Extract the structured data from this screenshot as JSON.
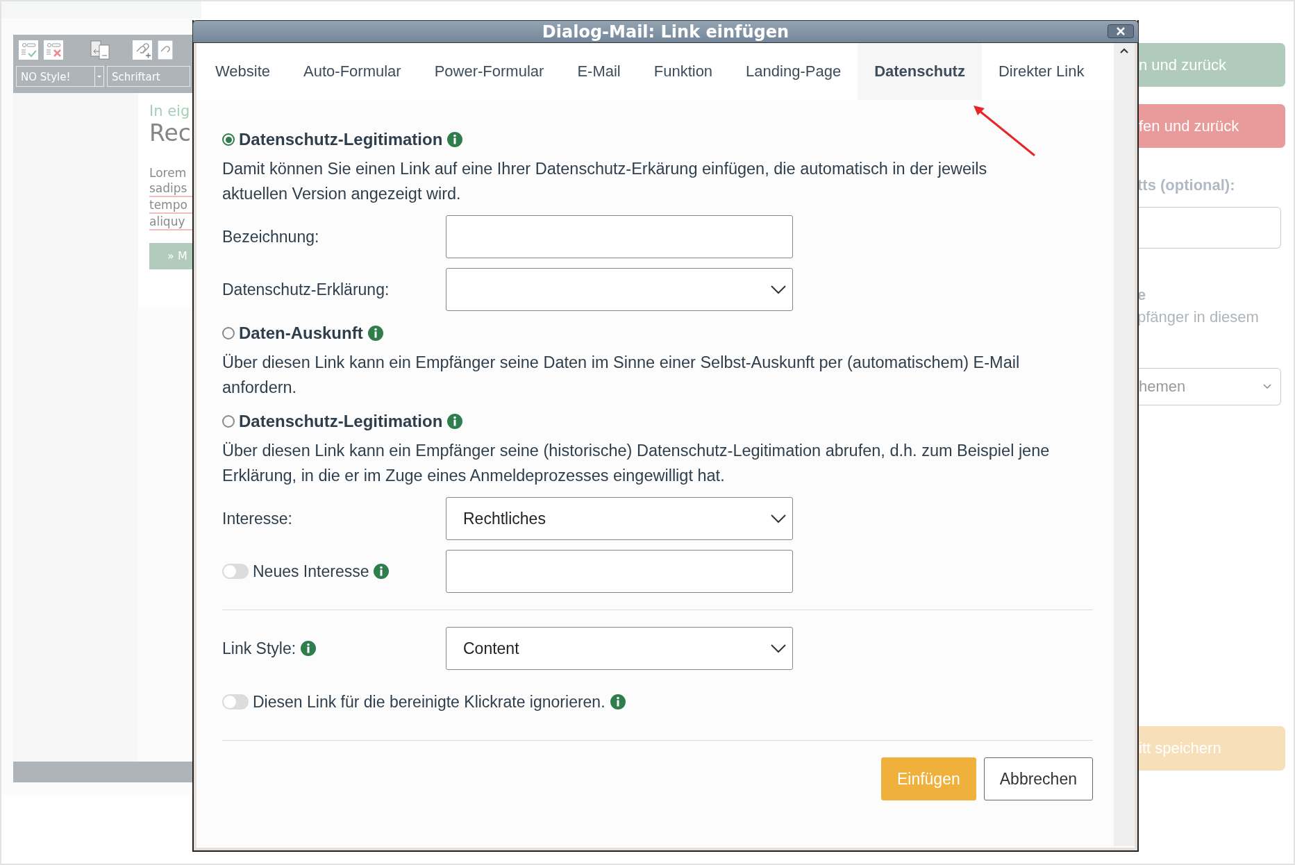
{
  "background": {
    "toolbar": {
      "style_select": "NO Style!",
      "font_select": "Schriftart"
    },
    "preview": {
      "kicker": "In eig",
      "heading": "Rec",
      "lines": [
        "Lorem",
        "sadips",
        "tempo",
        "aliquy"
      ],
      "button": "» M"
    },
    "right_panel": {
      "buttons": [
        {
          "label": "n und zurück",
          "kind": "save"
        },
        {
          "label": "fen und zurück",
          "kind": "discard"
        }
      ],
      "field_label": "tts (optional):",
      "note_title": "e",
      "note_text": "pfänger in diesem",
      "select_value": "hemen",
      "save_button": "itt speichern"
    }
  },
  "dialog": {
    "title": "Dialog-Mail: Link einfügen",
    "tabs": [
      {
        "label": "Website",
        "selected": false
      },
      {
        "label": "Auto-Formular",
        "selected": false
      },
      {
        "label": "Power-Formular",
        "selected": false
      },
      {
        "label": "E-Mail",
        "selected": false
      },
      {
        "label": "Funktion",
        "selected": false
      },
      {
        "label": "Landing-Page",
        "selected": false
      },
      {
        "label": "Datenschutz",
        "selected": true
      },
      {
        "label": "Direkter Link",
        "selected": false
      }
    ],
    "options": [
      {
        "label": "Datenschutz-Legitimation",
        "selected": true,
        "description": "Damit können Sie einen Link auf eine Ihrer Datenschutz-Erkärung einfügen, die automatisch in der jeweils aktuellen Version angezeigt wird.",
        "fields": [
          {
            "kind": "input",
            "label": "Bezeichnung:"
          },
          {
            "kind": "select",
            "label": "Datenschutz-Erklärung:"
          }
        ]
      },
      {
        "label": "Daten-Auskunft",
        "selected": false,
        "description": "Über diesen Link kann ein Empfänger seine Daten im Sinne einer Selbst-Auskunft per (automatischem) E-Mail anfordern."
      },
      {
        "label": "Datenschutz-Legitimation",
        "selected": false,
        "description": "Über diesen Link kann ein Empfänger seine (historische) Datenschutz-Legitimation abrufen, d.h. zum Beispiel jene Erklärung, in die er im Zuge eines Anmeldeprozesses eingewilligt hat.",
        "fields": [
          {
            "kind": "select",
            "label": "Interesse:",
            "value": "Rechtliches"
          },
          {
            "kind": "toggle",
            "label": "Neues Interesse",
            "on": false,
            "info": true
          }
        ]
      }
    ],
    "link_style": {
      "label": "Link Style:",
      "value": "Content"
    },
    "ignore_toggle": {
      "label": "Diesen Link für die bereinigte Klickrate ignorieren.",
      "on": false
    },
    "buttons": [
      {
        "label": "Einfügen",
        "kind": "primary"
      },
      {
        "label": "Abbrechen",
        "kind": "secondary"
      }
    ]
  }
}
